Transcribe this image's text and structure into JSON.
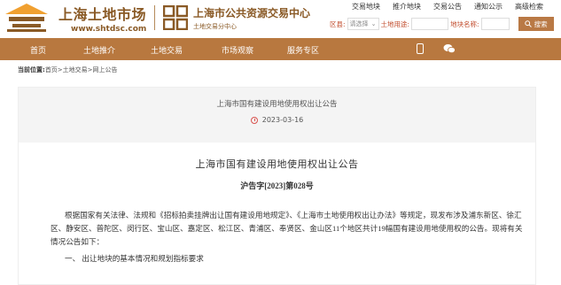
{
  "header": {
    "brand_cn": "上海土地市场",
    "brand_url": "www.shtdsc.com",
    "center_cn": "上海市公共资源交易中心",
    "center_sub": "土地交易分中心"
  },
  "toplinks": [
    "交易地块",
    "推介地块",
    "交易公告",
    "通知公示",
    "高级检索"
  ],
  "search": {
    "region_label": "区县:",
    "region_value": "请选择",
    "use_label": "土地用途:",
    "use_value": "",
    "name_label": "地块名称:",
    "name_value": "",
    "button_label": "搜索"
  },
  "nav": [
    "首页",
    "土地推介",
    "土地交易",
    "市场观察",
    "服务专区"
  ],
  "breadcrumb": {
    "label": "当前位置:",
    "path": "首页>土地交易>网上公告"
  },
  "notice": {
    "header_title": "上海市国有建设用地使用权出让公告",
    "date": "2023-03-16",
    "title": "上海市国有建设用地使用权出让公告",
    "number": "沪告字[2023]第028号",
    "paragraph": "根据国家有关法律、法规和《招标拍卖挂牌出让国有建设用地规定》、《上海市土地使用权出让办法》等规定，现发布涉及浦东新区、徐汇区、静安区、普陀区、闵行区、宝山区、嘉定区、松江区、青浦区、奉贤区、金山区11个地区共计19幅国有建设用地使用权的公告。现将有关情况公告如下：",
    "section1": "一、 出让地块的基本情况和规划指标要求"
  }
}
